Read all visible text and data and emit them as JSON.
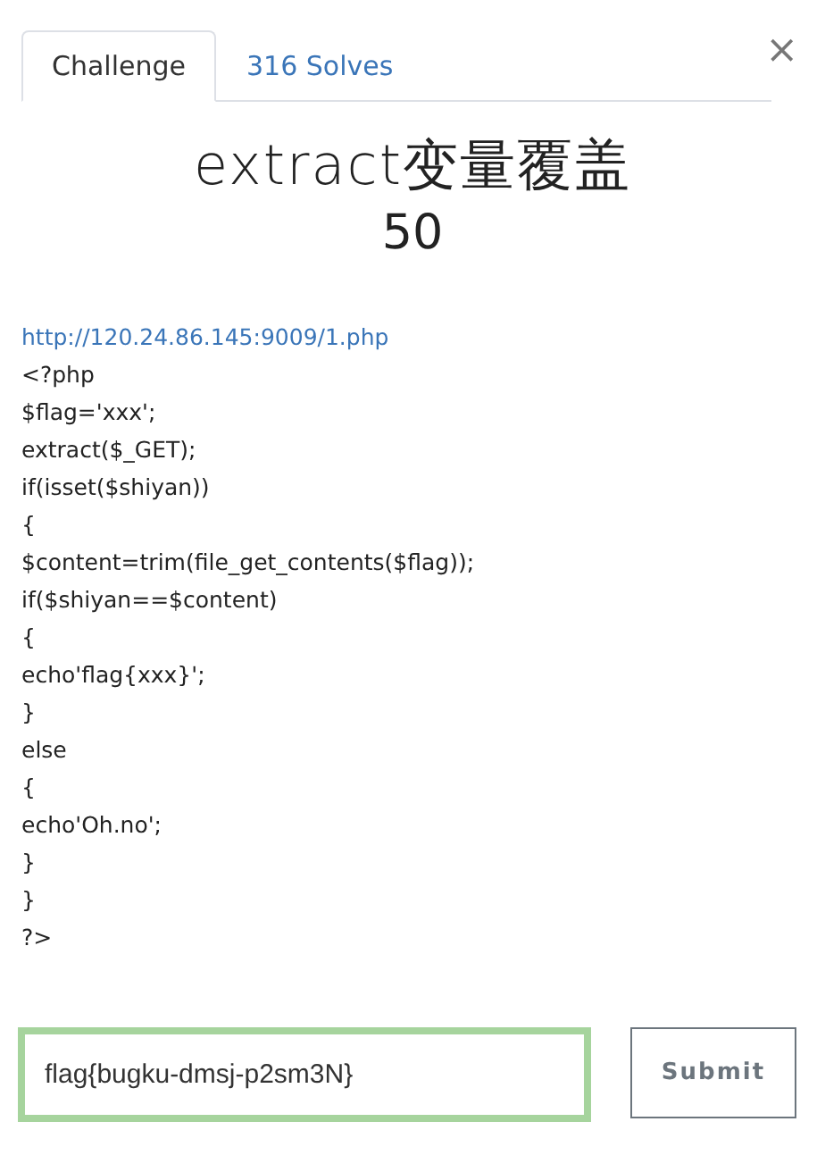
{
  "tabs": [
    {
      "label": "Challenge",
      "selected": true
    },
    {
      "label": "316 Solves",
      "selected": false
    }
  ],
  "close": "×",
  "challenge": {
    "title": "extract变量覆盖",
    "points": "50",
    "link": "http://120.24.86.145:9009/1.php",
    "code_lines": [
      "<?php",
      "$flag='xxx';",
      "extract($_GET);",
      "if(isset($shiyan))",
      "{",
      "$content=trim(file_get_contents($flag));",
      "if($shiyan==$content)",
      "{",
      "echo'flag{xxx}';",
      "}",
      "else",
      "{",
      "echo'Oh.no';",
      "}",
      "}",
      "?>"
    ]
  },
  "answer": {
    "value": "flag{bugku-dmsj-p2sm3N}",
    "focused": true
  },
  "submit": "Submit"
}
